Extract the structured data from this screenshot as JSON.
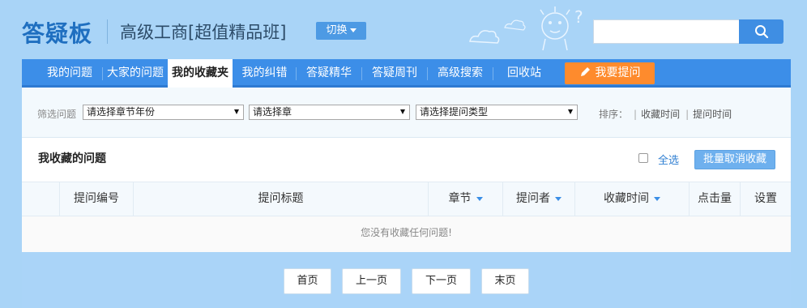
{
  "header": {
    "logo": "答疑板",
    "course": "高级工商[超值精品班]",
    "switch_label": "切换",
    "search": {
      "value": "",
      "placeholder": ""
    },
    "search_icon": "search-icon"
  },
  "nav": {
    "items": [
      {
        "label": "我的问题"
      },
      {
        "label": "大家的问题"
      },
      {
        "label": "我的收藏夹",
        "active": true
      },
      {
        "label": "我的纠错"
      },
      {
        "label": "答疑精华"
      },
      {
        "label": "答疑周刊"
      },
      {
        "label": "高级搜索"
      },
      {
        "label": "回收站"
      }
    ],
    "ask_label": "我要提问",
    "ask_icon": "pencil-icon"
  },
  "filter": {
    "label": "筛选问题",
    "selects": [
      {
        "value": "请选择章节年份"
      },
      {
        "value": "请选择章"
      },
      {
        "value": "请选择提问类型"
      }
    ],
    "sort_label": "排序：",
    "sort_options": [
      "收藏时间",
      "提问时间"
    ]
  },
  "favorites": {
    "title": "我收藏的问题",
    "select_all_label": "全选",
    "batch_cancel_label": "批量取消收藏",
    "columns": [
      "",
      "提问编号",
      "提问标题",
      "章节",
      "提问者",
      "收藏时间",
      "点击量",
      "设置"
    ],
    "empty_message": "您没有收藏任何问题!"
  },
  "pager": {
    "first": "首页",
    "prev": "上一页",
    "next": "下一页",
    "last": "末页"
  },
  "colors": {
    "background": "#a9d4f7",
    "nav": "#3c8ee8",
    "ask_button": "#fe8b2d",
    "logo": "#1f6fc0"
  }
}
